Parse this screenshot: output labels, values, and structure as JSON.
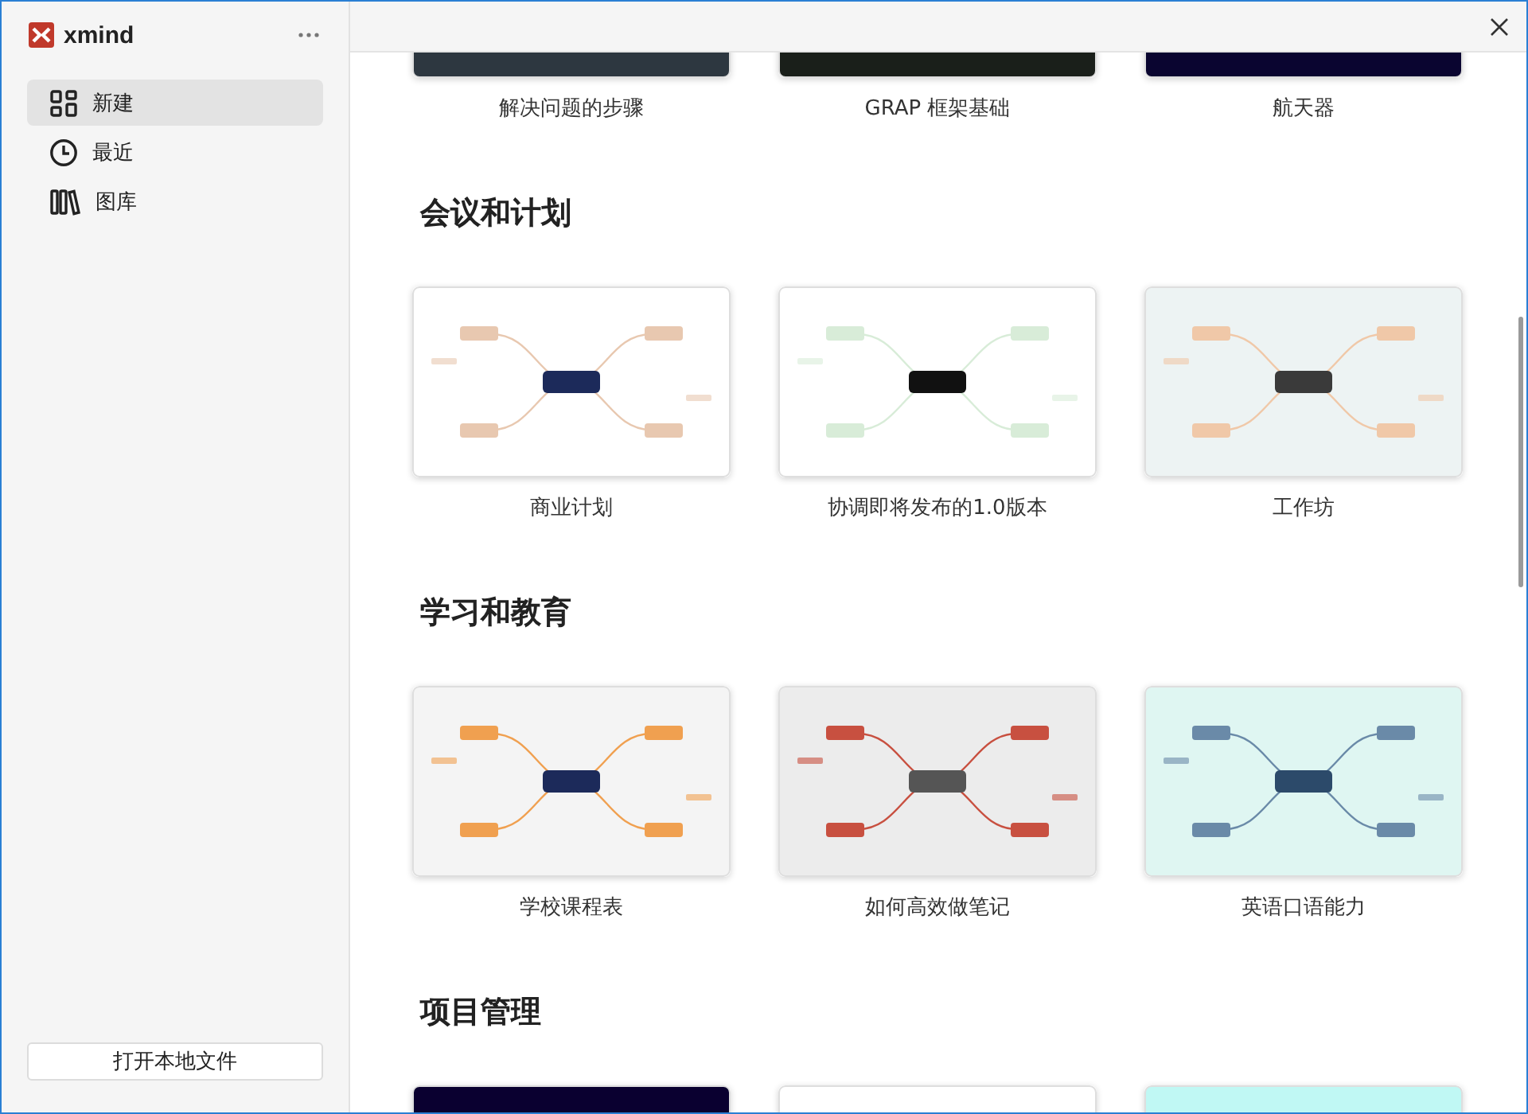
{
  "app": {
    "name": "xmind"
  },
  "sidebar": {
    "items": [
      {
        "label": "新建",
        "selected": true
      },
      {
        "label": "最近",
        "selected": false
      },
      {
        "label": "图库",
        "selected": false
      }
    ],
    "open_button": "打开本地文件"
  },
  "sections": [
    {
      "templates": [
        {
          "title": "解决问题的步骤"
        },
        {
          "title": "GRAP 框架基础"
        },
        {
          "title": "航天器"
        }
      ]
    },
    {
      "title": "会议和计划",
      "templates": [
        {
          "title": "商业计划"
        },
        {
          "title": "协调即将发布的1.0版本"
        },
        {
          "title": "工作坊"
        }
      ]
    },
    {
      "title": "学习和教育",
      "templates": [
        {
          "title": "学校课程表"
        },
        {
          "title": "如何高效做笔记"
        },
        {
          "title": "英语口语能力"
        }
      ]
    },
    {
      "title": "项目管理"
    }
  ]
}
